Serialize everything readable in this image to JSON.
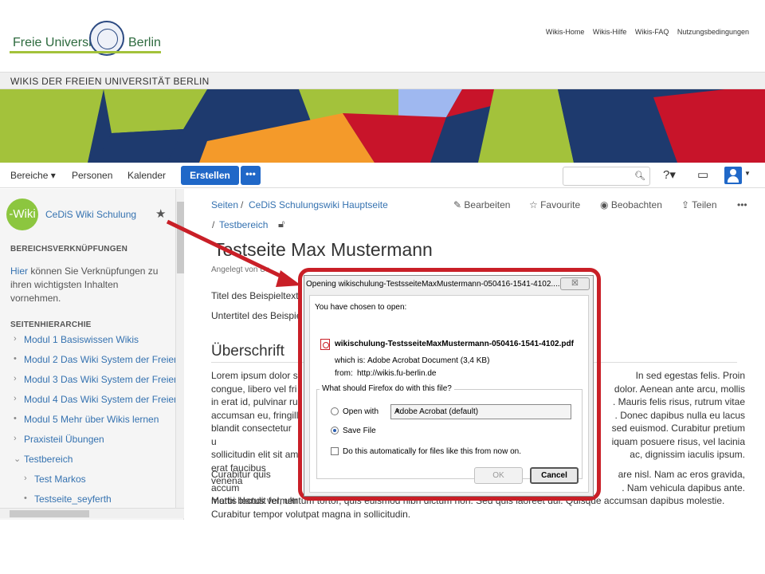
{
  "header": {
    "logo_left": "Freie Universität",
    "logo_right": "Berlin",
    "links": [
      "Wikis-Home",
      "Wikis-Hilfe",
      "Wikis-FAQ",
      "Nutzungsbedingungen"
    ]
  },
  "wikibar": {
    "title": "WIKIS DER FREIEN UNIVERSITÄT BERLIN"
  },
  "nav": {
    "spaces": "Bereiche ▾",
    "people": "Personen",
    "calendar": "Kalender",
    "create": "Erstellen",
    "more": "•••",
    "help_icon": "?▾",
    "notifications_icon": "inbox-icon",
    "user_icon": "avatar"
  },
  "sidebar": {
    "logo_text": "-Wiki",
    "space_name": "CeDiS Wiki Schulung",
    "links_heading": "BEREICHSVERKNÜPFUNGEN",
    "links_text_link": "Hier",
    "links_text_rest": " können Sie Verknüpfungen zu ihren wichtigsten Inhalten vornehmen.",
    "tree_heading": "SEITENHIERARCHIE",
    "tree": [
      {
        "label": "Modul 1 Basiswissen Wikis",
        "arrow": "›"
      },
      {
        "label": "Modul 2 Das Wiki System der Freien",
        "arrow": "•"
      },
      {
        "label": "Modul 3 Das Wiki System der Freien",
        "arrow": "›"
      },
      {
        "label": "Modul 4 Das Wiki System der Freien",
        "arrow": "›"
      },
      {
        "label": "Modul 5 Mehr über Wikis lernen",
        "arrow": "•"
      },
      {
        "label": "Praxisteil Übungen",
        "arrow": "›"
      },
      {
        "label": "Testbereich",
        "arrow": "⌄"
      },
      {
        "label": "Test Markos",
        "arrow": "›"
      },
      {
        "label": "Testseite_seyferth",
        "arrow": "•"
      }
    ]
  },
  "breadcrumb": {
    "item1": "Seiten",
    "item2": "CeDiS Schulungswiki Hauptseite",
    "item3": "Testbereich"
  },
  "actions": {
    "edit": "Bearbeiten",
    "favourite": "Favourite",
    "watch": "Beobachten",
    "share": "Teilen",
    "more": "•••"
  },
  "page": {
    "title": "Testseite Max Mustermann",
    "created_by": "Angelegt von Us",
    "line1": "Titel des Beispieltext",
    "line2": "Untertitel des Beispie",
    "heading": "Überschrift",
    "para1_left": "Lorem ipsum dolor s\ncongue, libero vel fri\nin erat id, pulvinar ru\naccumsan eu, fringill\nblandit consectetur u\nsollicitudin elit sit am\nerat faucibus venena",
    "para1_right": "In sed egestas felis. Proin\ndolor. Aenean ante arcu, mollis\n. Mauris felis risus, rutrum vitae\n. Donec dapibus nulla eu lacus\nsed euismod. Curabitur pretium\niquam posuere risus, vel lacinia\nac, dignissim iaculis ipsum.",
    "para2_top_left": "Curabitur quis accum\nmattis lectus vel, ultr",
    "para2_top_right": "are nisl. Nam ac eros gravida,\n. Nam vehicula dapibus ante.",
    "para2_bottom": "Morbi blandit fermentum tortor, quis euismod nibh dictum non. Sed quis laoreet dui. Quisque accumsan dapibus molestie.\nCurabitur tempor volutpat magna in sollicitudin."
  },
  "dialog": {
    "title": "Opening wikischulung-TestsseiteMaxMustermann-050416-1541-4102....",
    "close": "☒",
    "chosen": "You have chosen to open:",
    "filename": "wikischulung-TestsseiteMaxMustermann-050416-1541-4102.pdf",
    "which_is_label": "which is:",
    "which_is_value": "Adobe Acrobat Document (3,4 KB)",
    "from_label": "from:",
    "from_value": "http://wikis.fu-berlin.de",
    "question": "What should Firefox do with this file?",
    "open_with": "Open with",
    "open_with_app": "Adobe Acrobat  (default)",
    "save_file": "Save File",
    "auto": "Do this automatically for files like this from now on.",
    "ok": "OK",
    "cancel": "Cancel"
  },
  "colors": {
    "accent": "#2068c8",
    "highlight_frame": "#c91f27",
    "fu_green": "#a3c23b"
  }
}
